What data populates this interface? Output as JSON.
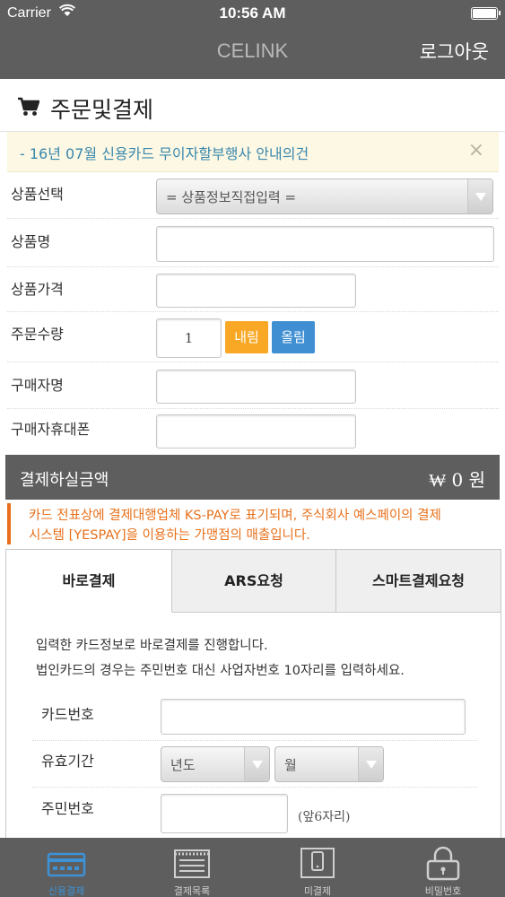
{
  "status_bar": {
    "carrier": "Carrier",
    "time": "10:56 AM"
  },
  "navbar": {
    "title": "CELINK",
    "logout": "로그아웃"
  },
  "page": {
    "title": "주문및결제",
    "icon": "cart-icon"
  },
  "notice": {
    "text": "- 16년 07월 신용카드 무이자할부행사 안내의건",
    "close": "×"
  },
  "order_form": {
    "product_select_label": "상품선택",
    "product_select_value": "= 상품정보직접입력 =",
    "product_name_label": "상품명",
    "product_name_value": "",
    "product_price_label": "상품가격",
    "product_price_value": "",
    "quantity_label": "주문수량",
    "quantity_value": "1",
    "decrease_label": "내림",
    "increase_label": "올림",
    "buyer_name_label": "구매자명",
    "buyer_name_value": "",
    "buyer_phone_label": "구매자휴대폰",
    "buyer_phone_value": ""
  },
  "amount": {
    "label": "결제하실금액",
    "value": "₩ 0 원"
  },
  "warning": {
    "line1": "카드 전표상에 결제대행업체 KS-PAY로 표기되며, 주식회사 예스페이의 결제",
    "line2": "시스템 [YESPAY]을 이용하는 가맹점의 매출입니다."
  },
  "payment_tabs": [
    {
      "label": "바로결제",
      "active": true
    },
    {
      "label": "ARS요청",
      "active": false
    },
    {
      "label": "스마트결제요청",
      "active": false
    }
  ],
  "direct_payment": {
    "desc_line1": "입력한 카드정보로 바로결제를 진행합니다.",
    "desc_line2": "법인카드의 경우는 주민번호 대신 사업자번호 10자리를 입력하세요.",
    "card_number_label": "카드번호",
    "card_number_value": "",
    "expiry_label": "유효기간",
    "expiry_year": "년도",
    "expiry_month": "월",
    "id_number_label": "주민번호",
    "id_number_value": "",
    "id_number_hint": "(앞6자리)"
  },
  "tab_bar": [
    {
      "label": "신용결제",
      "icon": "card-terminal-icon",
      "active": true
    },
    {
      "label": "결제목록",
      "icon": "list-icon",
      "active": false
    },
    {
      "label": "미결제",
      "icon": "mobile-icon",
      "active": false
    },
    {
      "label": "비밀번호",
      "icon": "lock-icon",
      "active": false
    }
  ],
  "colors": {
    "bar_gray": "#5f5e5e",
    "accent_blue": "#3c92d6",
    "accent_orange": "#f9a825",
    "warning_orange": "#e8701a",
    "notice_bg": "#fcf8e3"
  }
}
